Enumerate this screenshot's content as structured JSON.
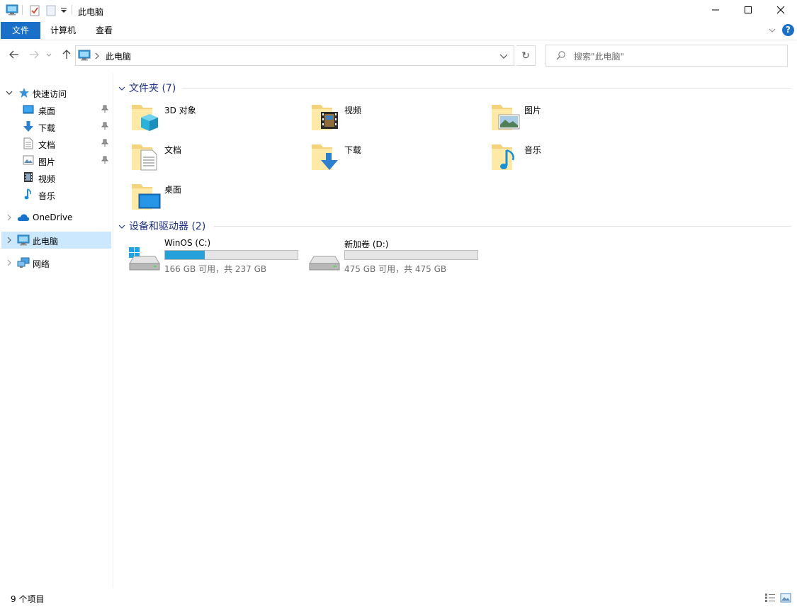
{
  "window": {
    "title": "此电脑",
    "controls": {
      "minimize": "minimize-icon",
      "maximize": "maximize-icon",
      "close": "close-icon"
    }
  },
  "ribbon": {
    "tabs": [
      {
        "label": "文件",
        "active": true
      },
      {
        "label": "计算机"
      },
      {
        "label": "查看"
      }
    ],
    "help": "?"
  },
  "address": {
    "path": "此电脑",
    "search_placeholder": "搜索\"此电脑\""
  },
  "sidebar": {
    "quick_access": "快速访问",
    "quick_items": [
      {
        "label": "桌面",
        "icon": "desktop-icon",
        "pinned": true
      },
      {
        "label": "下载",
        "icon": "download-icon",
        "pinned": true
      },
      {
        "label": "文档",
        "icon": "documents-icon",
        "pinned": true
      },
      {
        "label": "图片",
        "icon": "pictures-icon",
        "pinned": true
      },
      {
        "label": "视频",
        "icon": "videos-icon",
        "pinned": false
      },
      {
        "label": "音乐",
        "icon": "music-icon",
        "pinned": false
      }
    ],
    "onedrive": "OneDrive",
    "this_pc": "此电脑",
    "network": "网络"
  },
  "content": {
    "folders_header": "文件夹 (7)",
    "folders": [
      {
        "label": "3D 对象",
        "icon": "3d-objects-folder-icon"
      },
      {
        "label": "视频",
        "icon": "videos-folder-icon"
      },
      {
        "label": "图片",
        "icon": "pictures-folder-icon"
      },
      {
        "label": "文档",
        "icon": "documents-folder-icon"
      },
      {
        "label": "下载",
        "icon": "downloads-folder-icon"
      },
      {
        "label": "音乐",
        "icon": "music-folder-icon"
      },
      {
        "label": "桌面",
        "icon": "desktop-folder-icon"
      }
    ],
    "drives_header": "设备和驱动器 (2)",
    "drives": [
      {
        "name": "WinOS (C:)",
        "free": "166 GB 可用，共 237 GB",
        "used_fraction": 0.3,
        "icon": "windows-drive-icon"
      },
      {
        "name": "新加卷 (D:)",
        "free": "475 GB 可用，共 475 GB",
        "used_fraction": 0.0,
        "icon": "drive-icon"
      }
    ]
  },
  "status": {
    "items": "9 个项目"
  },
  "colors": {
    "accent": "#1a6fc9",
    "selection": "#cce8ff",
    "group_header": "#1e3287",
    "drive_fill": "#26a0da"
  }
}
